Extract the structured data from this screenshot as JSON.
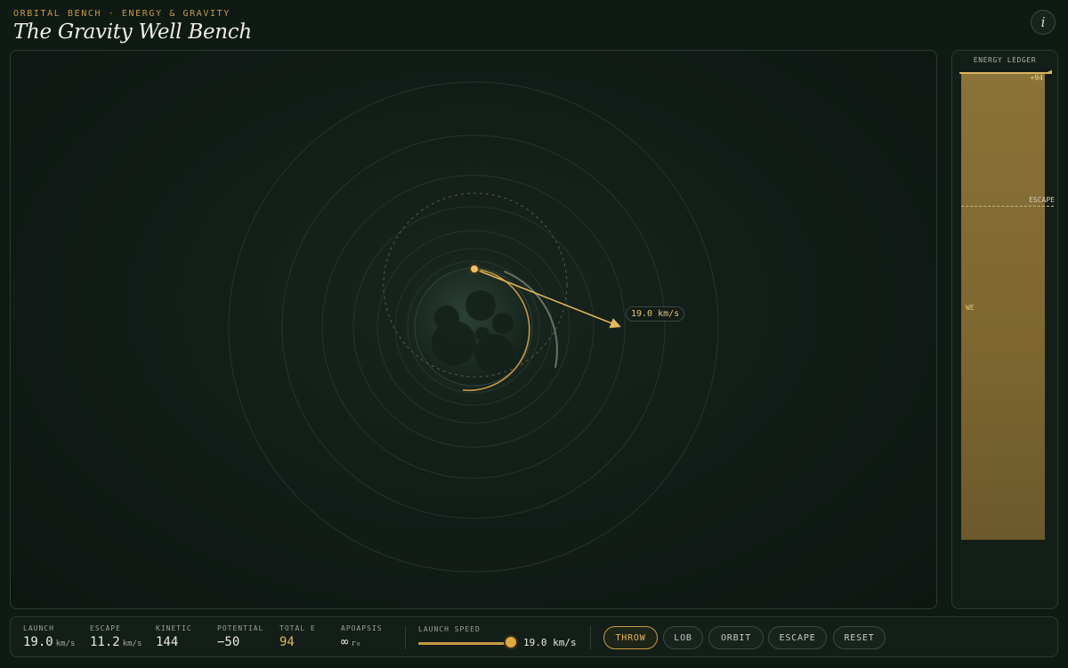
{
  "header": {
    "eyebrow": "ORBITAL BENCH · ENERGY & GRAVITY",
    "title": "The Gravity Well Bench",
    "info_label": "i"
  },
  "stage": {
    "velocity_label": "19.0 km/s"
  },
  "ledger": {
    "title": "ENERGY LEDGER",
    "total_marker": "+94",
    "escape_label": "ESCAPE",
    "well_label": "WE"
  },
  "stats": {
    "launch": {
      "label": "LAUNCH",
      "value": "19.0",
      "unit": "km/s"
    },
    "escape": {
      "label": "ESCAPE",
      "value": "11.2",
      "unit": "km/s"
    },
    "kinetic": {
      "label": "KINETIC",
      "value": "144"
    },
    "potential": {
      "label": "POTENTIAL",
      "value": "−50"
    },
    "total": {
      "label": "TOTAL E",
      "value": "94"
    },
    "apoapsis": {
      "label": "APOAPSIS",
      "value": "∞",
      "unit": "r₀"
    }
  },
  "slider": {
    "label": "LAUNCH SPEED",
    "value_text": "19.0 km/s",
    "fraction": 1.0
  },
  "buttons": {
    "throw": "THROW",
    "lob": "LOB",
    "orbit": "ORBIT",
    "escape": "ESCAPE",
    "reset": "RESET"
  },
  "colors": {
    "accent": "#e6b85a",
    "background": "#0f1a15",
    "panel": "#131e18"
  }
}
